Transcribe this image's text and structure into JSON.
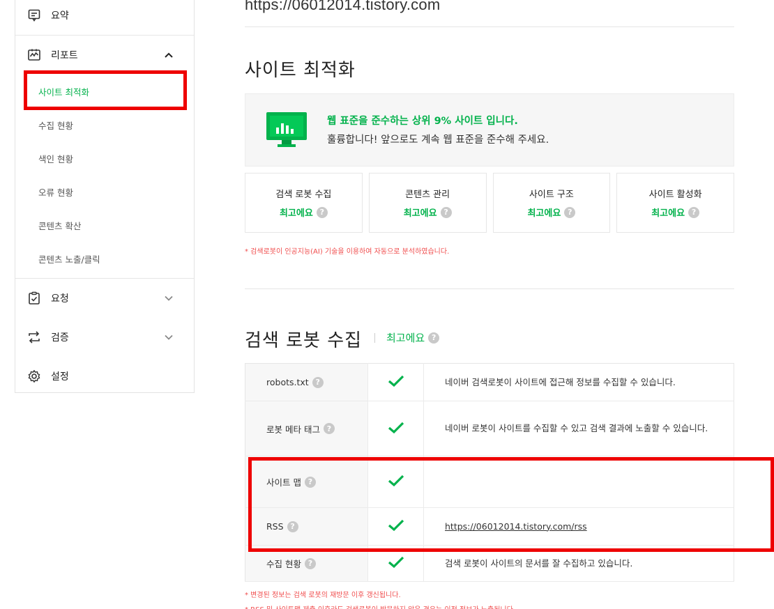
{
  "sidebar": {
    "summary_label": "요약",
    "report_label": "리포트",
    "report_sub": [
      "사이트 최적화",
      "수집 현황",
      "색인 현황",
      "오류 현황",
      "콘텐츠 확산",
      "콘텐츠 노출/클릭"
    ],
    "request_label": "요청",
    "verify_label": "검증",
    "settings_label": "설정"
  },
  "main": {
    "site_url": "https://06012014.tistory.com",
    "section1_title": "사이트 최적화",
    "notice_headline": "웹 표준을 준수하는 상위 9% 사이트 입니다.",
    "notice_sub": "훌륭합니다! 앞으로도 계속 웹 표준을 준수해 주세요.",
    "cards": [
      {
        "name": "검색 로봇 수집",
        "grade": "최고에요"
      },
      {
        "name": "콘텐츠 관리",
        "grade": "최고에요"
      },
      {
        "name": "사이트 구조",
        "grade": "최고에요"
      },
      {
        "name": "사이트 활성화",
        "grade": "최고에요"
      }
    ],
    "ai_note": "* 검색로봇이 인공지능(AI) 기술을 이용하여 자동으로 분석하였습니다.",
    "section2_title": "검색 로봇 수집",
    "section2_grade": "최고에요",
    "rows": [
      {
        "label": "robots.txt",
        "desc": "네이버 검색로봇이 사이트에 접근해 정보를 수집할 수 있습니다."
      },
      {
        "label": "로봇 메타 태그",
        "desc": "네이버 로봇이 사이트를 수집할 수 있고 검색 결과에 노출할 수 있습니다."
      },
      {
        "label": "사이트 맵",
        "desc": ""
      },
      {
        "label": "RSS",
        "desc": "https://06012014.tistory.com/rss"
      },
      {
        "label": "수집 현황",
        "desc": "검색 로봇이 사이트의 문서를 잘 수집하고 있습니다."
      }
    ],
    "footnote1": "* 변경된 정보는 검색 로봇의 재방문 이후 갱신됩니다.",
    "footnote2": "* RSS 및 사이트맵 제출 이후라도 검색로봇이 방문하지 않은 경우는 이전 정보가 노출됩니다."
  },
  "colors": {
    "accent": "#03b24c",
    "highlight": "#ee0000",
    "note": "#f04e4e"
  },
  "icons": [
    "summary-icon",
    "report-icon",
    "request-icon",
    "verify-icon",
    "settings-icon",
    "chevron-up-icon",
    "chevron-down-icon",
    "help-icon",
    "check-icon",
    "monitor-chart-icon"
  ]
}
